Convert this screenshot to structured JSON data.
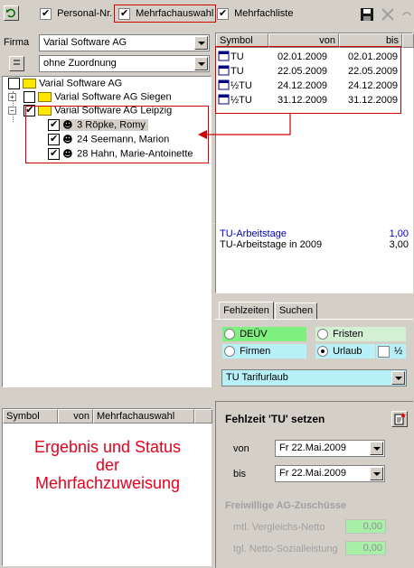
{
  "toolbar": {
    "personal_nr_label": "Personal-Nr.",
    "mehrfachauswahl_label": "Mehrfachauswahl",
    "mehrfachliste_label": "Mehrfachliste"
  },
  "filter": {
    "firma_label": "Firma",
    "firma_value": "Varial Software AG",
    "zuordnung_value": "ohne Zuordnung"
  },
  "tree": {
    "root": "Varial Software AG",
    "child1": "Varial Software AG Siegen",
    "child2": "Varial Software AG Leipzig",
    "persons": [
      "3 Röpke, Romy",
      "24 Seemann, Marion",
      "28 Hahn, Marie-Antoinette"
    ]
  },
  "list": {
    "headers": [
      "Symbol",
      "von",
      "bis"
    ],
    "rows": [
      {
        "symbol": "TU",
        "von": "02.01.2009",
        "bis": "02.01.2009"
      },
      {
        "symbol": "TU",
        "von": "22.05.2009",
        "bis": "22.05.2009"
      },
      {
        "symbol": "½TU",
        "von": "24.12.2009",
        "bis": "24.12.2009"
      },
      {
        "symbol": "½TU",
        "von": "31.12.2009",
        "bis": "31.12.2009"
      }
    ]
  },
  "summary": {
    "tu_arbeitstage_label": "TU-Arbeitstage",
    "tu_arbeitstage_value": "1,00",
    "tu_arbeitstage_2009_label": "TU-Arbeitstage in 2009",
    "tu_arbeitstage_2009_value": "3,00"
  },
  "result": {
    "headers": [
      "Symbol",
      "von",
      "Mehrfachauswahl"
    ],
    "caption_lines": [
      "Ergebnis und Status",
      "der",
      "Mehrfachzuweisung"
    ]
  },
  "tabs": {
    "fehlzeiten": "Fehlzeiten",
    "suchen": "Suchen"
  },
  "options": {
    "deuev": "DEÜV",
    "fristen": "Fristen",
    "firmen": "Firmen",
    "urlaub": "Urlaub",
    "half": "½"
  },
  "type_select": "TU Tarifurlaub",
  "form": {
    "title": "Fehlzeit 'TU' setzen",
    "von_label": "von",
    "von_value": "Fr  22.Mai.2009",
    "bis_label": "bis",
    "bis_value": "Fr  22.Mai.2009",
    "zuschuesse_title": "Freiwillige AG-Zuschüsse",
    "vergleichs_label": "mtl. Vergleichs-Netto",
    "vergleichs_value": "0,00",
    "sozial_label": "tgl. Netto-Sozialleistung",
    "sozial_value": "0,00"
  },
  "colors": {
    "highlight_red": "#d00000",
    "caption_red": "#e8001c",
    "deuev_bg": "#7ff07f",
    "firmen_bg": "#b8f0f8",
    "select_bg": "#b8f0f8",
    "input_green": "#a8f0a8",
    "summary_blue": "#0000c0"
  }
}
